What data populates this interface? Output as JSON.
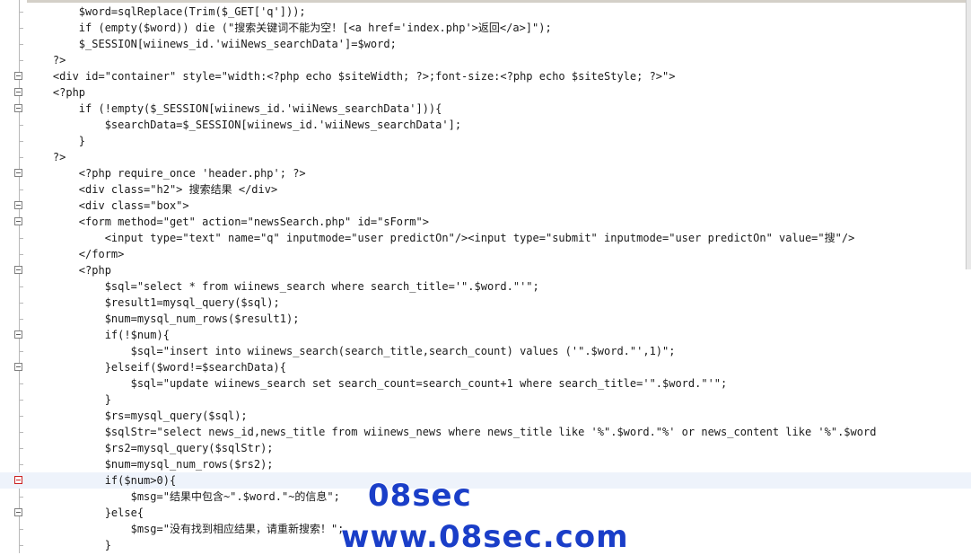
{
  "editor": {
    "lines": [
      {
        "fold": "",
        "text": "        $word=sqlReplace(Trim($_GET['q']));"
      },
      {
        "fold": "",
        "text": "        if (empty($word)) die (\"搜索关键词不能为空！[<a href='index.php'>返回</a>]\");"
      },
      {
        "fold": "",
        "text": "        $_SESSION[wiinews_id.'wiiNews_searchData']=$word;"
      },
      {
        "fold": "",
        "text": "    ?>"
      },
      {
        "fold": "fold",
        "text": "    <div id=\"container\" style=\"width:<?php echo $siteWidth; ?>;font-size:<?php echo $siteStyle; ?>\">"
      },
      {
        "fold": "fold",
        "text": "    <?php"
      },
      {
        "fold": "fold",
        "text": "        if (!empty($_SESSION[wiinews_id.'wiiNews_searchData'])){"
      },
      {
        "fold": "",
        "text": "            $searchData=$_SESSION[wiinews_id.'wiiNews_searchData'];"
      },
      {
        "fold": "",
        "text": "        }"
      },
      {
        "fold": "",
        "text": "    ?>"
      },
      {
        "fold": "fold",
        "text": "        <?php require_once 'header.php'; ?>"
      },
      {
        "fold": "",
        "text": "        <div class=\"h2\"> 搜索结果 </div>"
      },
      {
        "fold": "fold",
        "text": "        <div class=\"box\">"
      },
      {
        "fold": "fold",
        "text": "        <form method=\"get\" action=\"newsSearch.php\" id=\"sForm\">"
      },
      {
        "fold": "",
        "text": "            <input type=\"text\" name=\"q\" inputmode=\"user predictOn\"/><input type=\"submit\" inputmode=\"user predictOn\" value=\"搜\"/>"
      },
      {
        "fold": "",
        "text": "        </form>"
      },
      {
        "fold": "fold",
        "text": "        <?php"
      },
      {
        "fold": "",
        "text": "            $sql=\"select * from wiinews_search where search_title='\".$word.\"'\";"
      },
      {
        "fold": "",
        "text": "            $result1=mysql_query($sql);"
      },
      {
        "fold": "",
        "text": "            $num=mysql_num_rows($result1);"
      },
      {
        "fold": "fold",
        "text": "            if(!$num){"
      },
      {
        "fold": "",
        "text": "                $sql=\"insert into wiinews_search(search_title,search_count) values ('\".$word.\"',1)\";"
      },
      {
        "fold": "fold",
        "text": "            }elseif($word!=$searchData){"
      },
      {
        "fold": "",
        "text": "                $sql=\"update wiinews_search set search_count=search_count+1 where search_title='\".$word.\"'\";"
      },
      {
        "fold": "",
        "text": "            }"
      },
      {
        "fold": "",
        "text": "            $rs=mysql_query($sql);"
      },
      {
        "fold": "",
        "text": "            $sqlStr=\"select news_id,news_title from wiinews_news where news_title like '%\".$word.\"%' or news_content like '%\".$word"
      },
      {
        "fold": "",
        "text": "            $rs2=mysql_query($sqlStr);"
      },
      {
        "fold": "",
        "text": "            $num=mysql_num_rows($rs2);"
      },
      {
        "fold": "red",
        "text": "            if($num>0){"
      },
      {
        "fold": "",
        "text": "                $msg=\"结果中包含~\".$word.\"~的信息\";"
      },
      {
        "fold": "fold",
        "text": "            }else{"
      },
      {
        "fold": "",
        "text": "                $msg=\"没有找到相应结果，请重新搜索！\";"
      },
      {
        "fold": "",
        "text": "            }"
      }
    ],
    "active_line": 29
  },
  "watermark": {
    "line1": "08sec",
    "line2": "www.08sec.com"
  },
  "colors": {
    "keyword": "#00007a",
    "php_tag": "#c03000",
    "attribute": "#a00000",
    "value": "#0000b0",
    "watermark": "#1a3ec8"
  }
}
